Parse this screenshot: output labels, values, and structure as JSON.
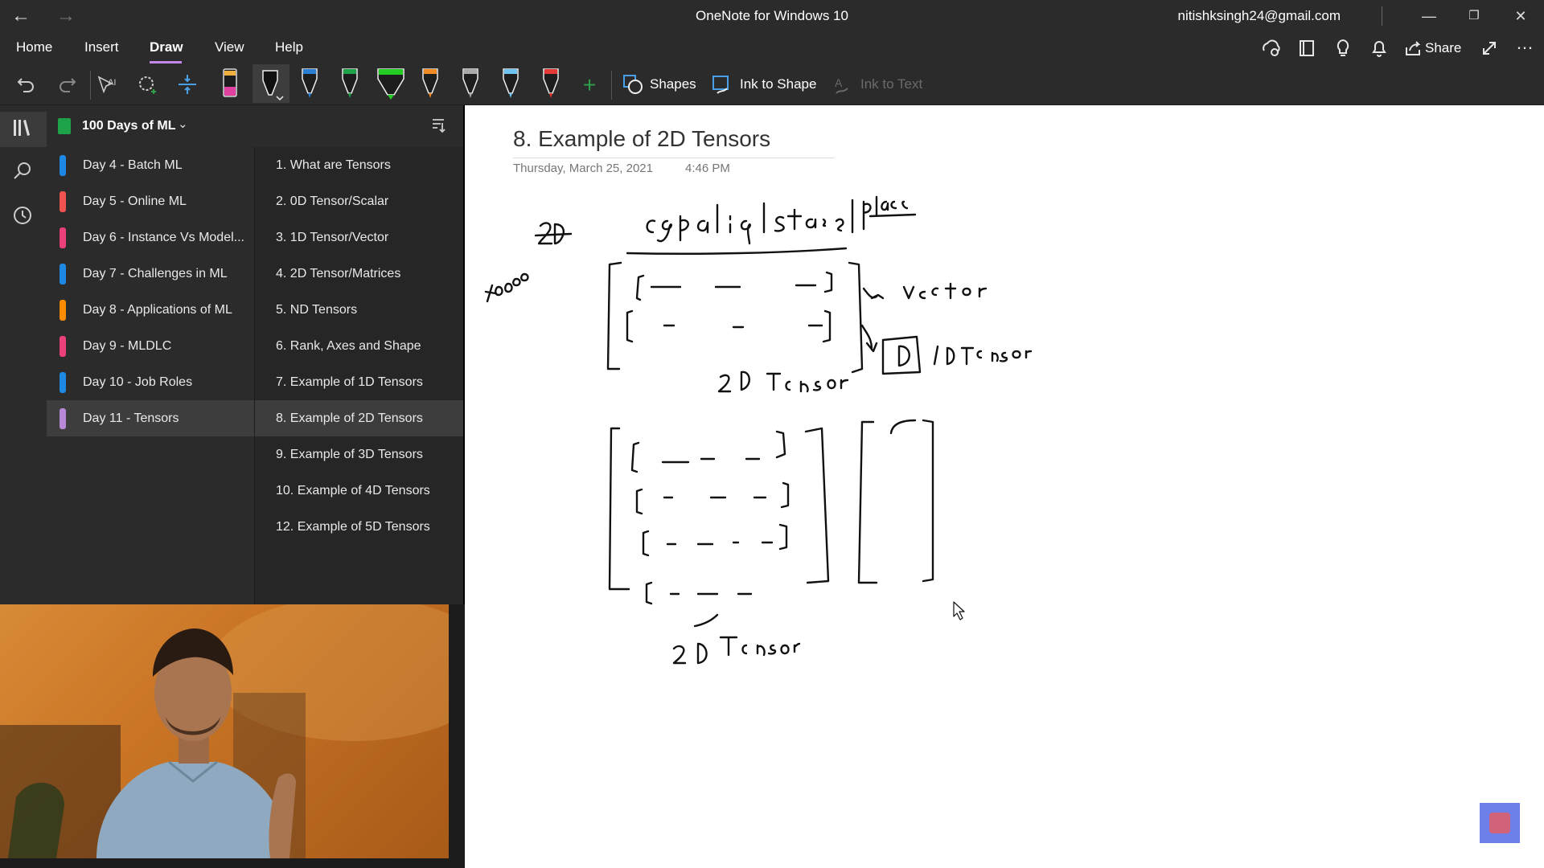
{
  "window": {
    "title": "OneNote for Windows 10",
    "account": "nitishksingh24@gmail.com",
    "back_icon": "back-arrow-icon",
    "forward_icon": "forward-arrow-icon"
  },
  "menu": {
    "items": [
      "Home",
      "Insert",
      "Draw",
      "View",
      "Help"
    ],
    "active": "Draw",
    "share_label": "Share"
  },
  "toolbar": {
    "shapes_label": "Shapes",
    "ink_to_shape_label": "Ink to Shape",
    "ink_to_text_label": "Ink to Text",
    "pens": [
      {
        "name": "highlighter-pink",
        "color": "#e040a0"
      },
      {
        "name": "pen-black",
        "color": "#111111"
      },
      {
        "name": "pen-blue",
        "color": "#2a7fd4"
      },
      {
        "name": "pen-green",
        "color": "#1fa34a"
      },
      {
        "name": "highlighter-green",
        "color": "#22cc22"
      },
      {
        "name": "pen-orange",
        "color": "#f08a24"
      },
      {
        "name": "pen-gray",
        "color": "#aaaaaa"
      },
      {
        "name": "pen-lightblue",
        "color": "#6fc3f0"
      },
      {
        "name": "pen-red",
        "color": "#e53935"
      }
    ]
  },
  "notebook": {
    "name": "100 Days of ML",
    "sections": [
      {
        "label": "Day 4 - Batch ML",
        "color": "#1e88e5"
      },
      {
        "label": "Day 5 - Online ML",
        "color": "#ef5350"
      },
      {
        "label": "Day 6 - Instance Vs Model...",
        "color": "#ec407a"
      },
      {
        "label": "Day 7 - Challenges in ML",
        "color": "#1e88e5"
      },
      {
        "label": "Day 8 - Applications of ML",
        "color": "#fb8c00"
      },
      {
        "label": "Day 9 - MLDLC",
        "color": "#ec407a"
      },
      {
        "label": "Day 10 - Job Roles",
        "color": "#1e88e5"
      },
      {
        "label": "Day 11 - Tensors",
        "color": "#b889d9"
      }
    ],
    "selected_section": 7,
    "pages": [
      "1. What are Tensors",
      "2. 0D Tensor/Scalar",
      "3. 1D Tensor/Vector",
      "4. 2D Tensor/Matrices",
      "5. ND Tensors",
      "6. Rank, Axes and Shape",
      "7. Example of 1D Tensors",
      "8. Example of 2D Tensors",
      "9. Example of 3D Tensors",
      "10. Example of 4D Tensors",
      "12. Example of 5D Tensors"
    ],
    "selected_page": 7
  },
  "page": {
    "title": "8. Example of 2D Tensors",
    "date": "Thursday, March 25, 2021",
    "time": "4:46 PM"
  }
}
